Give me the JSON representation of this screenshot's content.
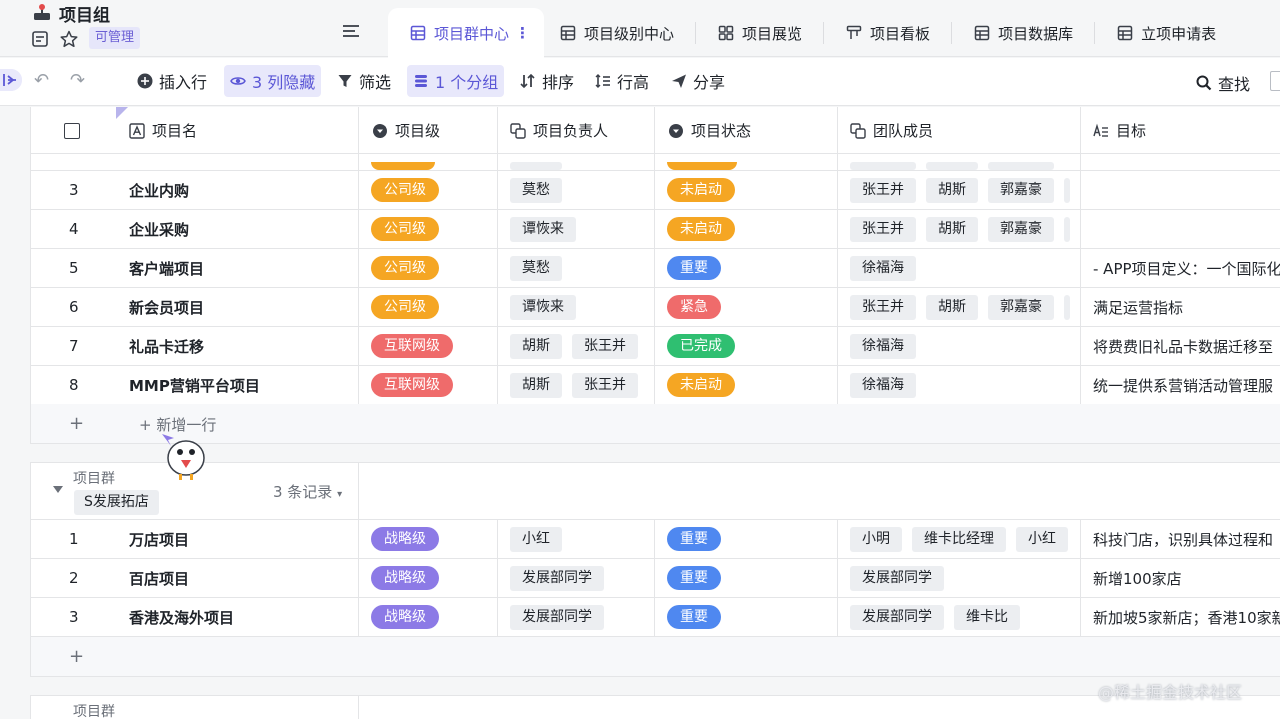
{
  "header": {
    "app_title": "项目组",
    "badge": "可管理"
  },
  "tabs": [
    {
      "label": "项目群中心",
      "active": true
    },
    {
      "label": "项目级别中心"
    },
    {
      "label": "项目展览"
    },
    {
      "label": "项目看板"
    },
    {
      "label": "项目数据库"
    },
    {
      "label": "立项申请表"
    }
  ],
  "toolbar": {
    "insert_row": "插入行",
    "hidden_cols": "3 列隐藏",
    "filter": "筛选",
    "group": "1 个分组",
    "sort": "排序",
    "row_height": "行高",
    "share": "分享",
    "search": "查找"
  },
  "columns": [
    "项目名",
    "项目级",
    "项目负责人",
    "项目状态",
    "团队成员",
    "目标"
  ],
  "colors": {
    "company": "#f5a623",
    "internet": "#ef6b6b",
    "strategy": "#8c7ae6",
    "not_started": "#f5a623",
    "important": "#4f88f0",
    "urgent": "#ef6b6b",
    "done": "#2fbf71",
    "accent": "#5b57d6"
  },
  "group1": {
    "rows": [
      {
        "num": "3",
        "name": "企业内购",
        "level": "公司级",
        "owners": [
          "莫愁"
        ],
        "status": "未启动",
        "members": [
          "张王并",
          "胡斯",
          "郭嘉豪"
        ],
        "goal": ""
      },
      {
        "num": "4",
        "name": "企业采购",
        "level": "公司级",
        "owners": [
          "谭恢来"
        ],
        "status": "未启动",
        "members": [
          "张王并",
          "胡斯",
          "郭嘉豪"
        ],
        "goal": ""
      },
      {
        "num": "5",
        "name": "客户端项目",
        "level": "公司级",
        "owners": [
          "莫愁"
        ],
        "status": "重要",
        "members": [
          "徐福海"
        ],
        "goal": "- APP项目定义：一个国际化"
      },
      {
        "num": "6",
        "name": "新会员项目",
        "level": "公司级",
        "owners": [
          "谭恢来"
        ],
        "status": "紧急",
        "members": [
          "张王并",
          "胡斯",
          "郭嘉豪"
        ],
        "goal": "满足运营指标"
      },
      {
        "num": "7",
        "name": "礼品卡迁移",
        "level": "互联网级",
        "owners": [
          "胡斯",
          "张王并"
        ],
        "status": "已完成",
        "members": [
          "徐福海"
        ],
        "goal": "将费费旧礼品卡数据迁移至"
      },
      {
        "num": "8",
        "name": "MMP营销平台项目",
        "level": "互联网级",
        "owners": [
          "胡斯",
          "张王并"
        ],
        "status": "未启动",
        "members": [
          "徐福海"
        ],
        "goal": "统一提供系营销活动管理服"
      }
    ],
    "add_row": "新增一行"
  },
  "group2": {
    "label": "项目群",
    "value": "S发展拓店",
    "count": "3 条记录",
    "rows": [
      {
        "num": "1",
        "name": "万店项目",
        "level": "战略级",
        "owners": [
          "小红"
        ],
        "status": "重要",
        "members": [
          "小明",
          "维卡比经理",
          "小红"
        ],
        "goal": "科技门店，识别具体过程和"
      },
      {
        "num": "2",
        "name": "百店项目",
        "level": "战略级",
        "owners": [
          "发展部同学"
        ],
        "status": "重要",
        "members": [
          "发展部同学"
        ],
        "goal": "新增100家店"
      },
      {
        "num": "3",
        "name": "香港及海外项目",
        "level": "战略级",
        "owners": [
          "发展部同学"
        ],
        "status": "重要",
        "members": [
          "发展部同学",
          "维卡比"
        ],
        "goal": "新加坡5家新店；香港10家新"
      }
    ]
  },
  "group3": {
    "label": "项目群"
  },
  "watermark": "@稀土掘金技术社区"
}
